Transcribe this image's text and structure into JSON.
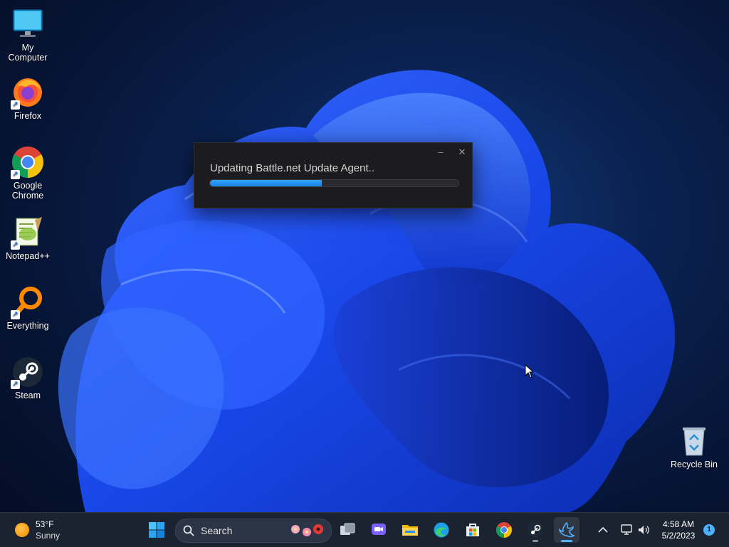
{
  "desktop": {
    "icons": [
      {
        "label": "My Computer"
      },
      {
        "label": "Firefox"
      },
      {
        "label": "Google Chrome"
      },
      {
        "label": "Notepad++"
      },
      {
        "label": "Everything"
      },
      {
        "label": "Steam"
      },
      {
        "label": "Recycle Bin"
      }
    ]
  },
  "updater": {
    "message": "Updating Battle.net Update Agent..",
    "progress": 0.45,
    "minimize_glyph": "–",
    "close_glyph": "✕"
  },
  "taskbar": {
    "weather": {
      "temp": "53°F",
      "condition": "Sunny"
    },
    "search_placeholder": "Search",
    "apps": [
      "start-icon",
      "task-view-icon",
      "teams-icon",
      "file-explorer-icon",
      "edge-icon",
      "store-icon",
      "chrome-icon",
      "steam-icon",
      "battlenet-icon"
    ],
    "clock": {
      "time": "4:58 AM",
      "date": "5/2/2023"
    },
    "notification_count": "1"
  },
  "colors": {
    "accent": "#1682e6",
    "taskbar": "#1c2330",
    "dialog": "#1c1c1f"
  }
}
